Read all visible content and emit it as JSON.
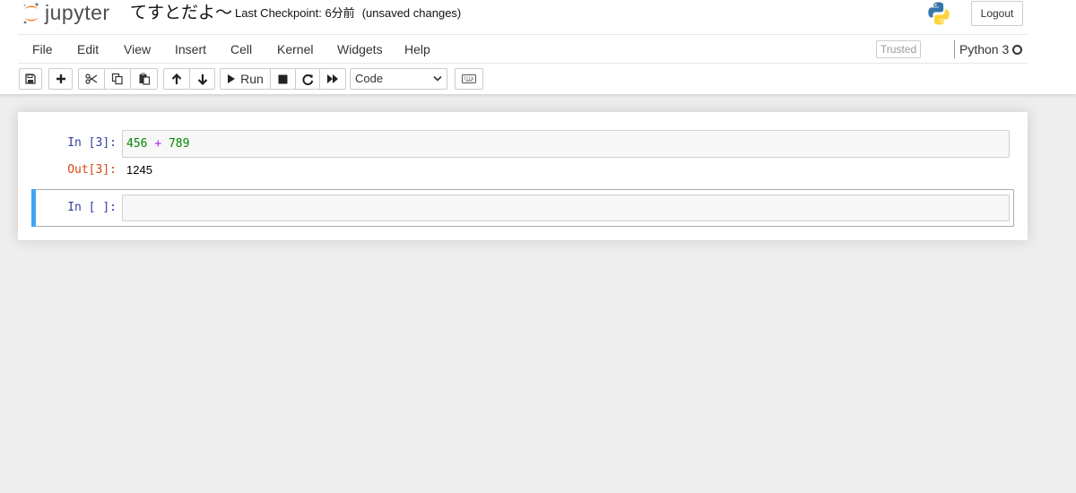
{
  "header": {
    "logo_text": "jupyter",
    "notebook_name": "てすとだよ〜",
    "checkpoint": "Last Checkpoint: 6分前",
    "autosave": "(unsaved changes)",
    "logout_label": "Logout"
  },
  "menubar": {
    "items": [
      "File",
      "Edit",
      "View",
      "Insert",
      "Cell",
      "Kernel",
      "Widgets",
      "Help"
    ],
    "trusted_label": "Trusted",
    "kernel_name": "Python 3"
  },
  "toolbar": {
    "run_label": "Run",
    "cell_type": "Code"
  },
  "cells": [
    {
      "in_prompt": "In [3]:",
      "code": {
        "left": "456",
        "op": "+",
        "right": "789"
      },
      "out_prompt": "Out[3]:",
      "output": "1245"
    },
    {
      "in_prompt": "In [ ]:",
      "code_text": ""
    }
  ],
  "colors": {
    "accent": "#f37726",
    "in_prompt": "#303f9f",
    "out_prompt": "#d84315",
    "selected_cell": "#42a5f5"
  }
}
